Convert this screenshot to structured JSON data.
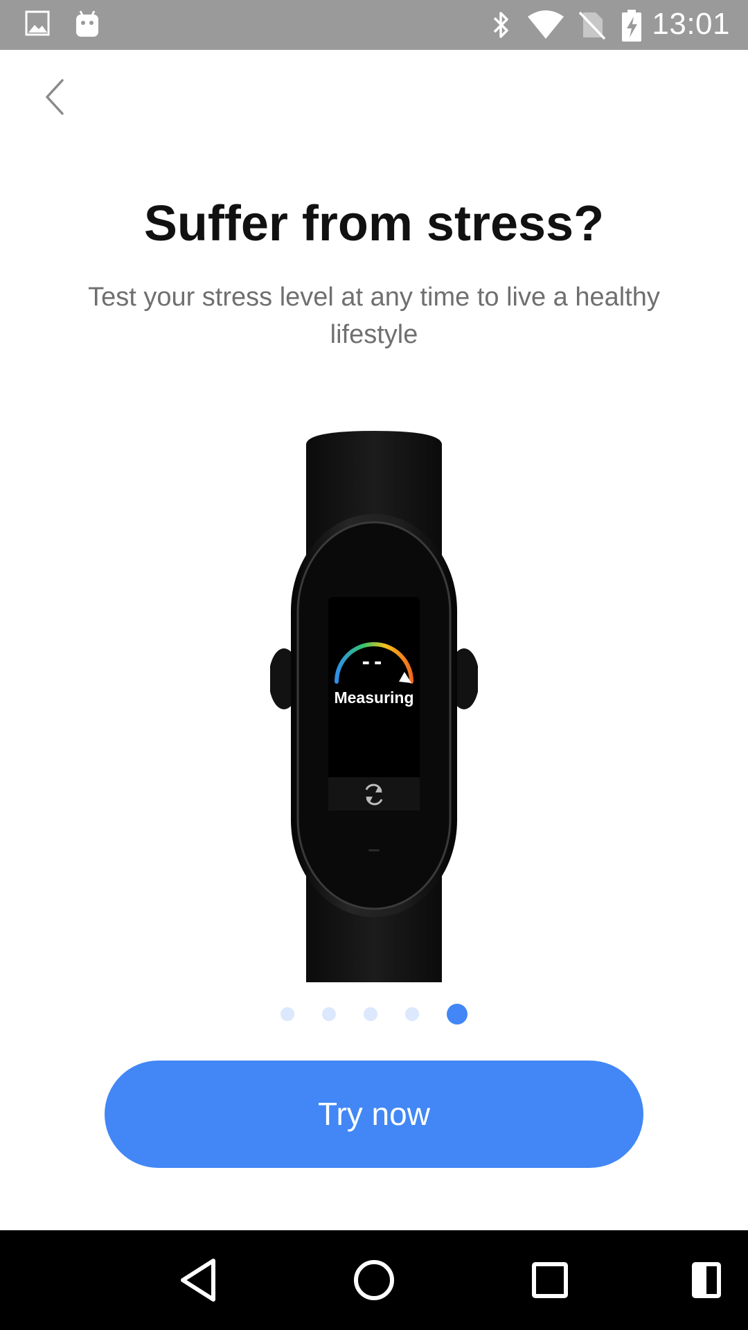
{
  "status_bar": {
    "time": "13:01",
    "left_icons": [
      "gallery-icon",
      "android-icon"
    ],
    "right_icons": [
      "bluetooth-icon",
      "wifi-icon",
      "no-sim-icon",
      "battery-charging-icon"
    ]
  },
  "header": {
    "back_icon": "chevron-left-icon"
  },
  "main": {
    "title": "Suffer from stress?",
    "subtitle": "Test your stress level at any time to live a healthy lifestyle",
    "device_screen": {
      "value": "--",
      "status": "Measuring",
      "refresh_icon": "refresh-icon"
    },
    "pager": {
      "count": 5,
      "active_index": 4
    },
    "cta_label": "Try now"
  },
  "nav_bar": {
    "buttons": [
      "back-triangle-icon",
      "home-circle-icon",
      "recents-square-icon",
      "split-screen-icon"
    ]
  },
  "colors": {
    "accent": "#4287f5",
    "status_bar": "#9a9a9a",
    "dot_inactive": "#dbe8fd"
  }
}
